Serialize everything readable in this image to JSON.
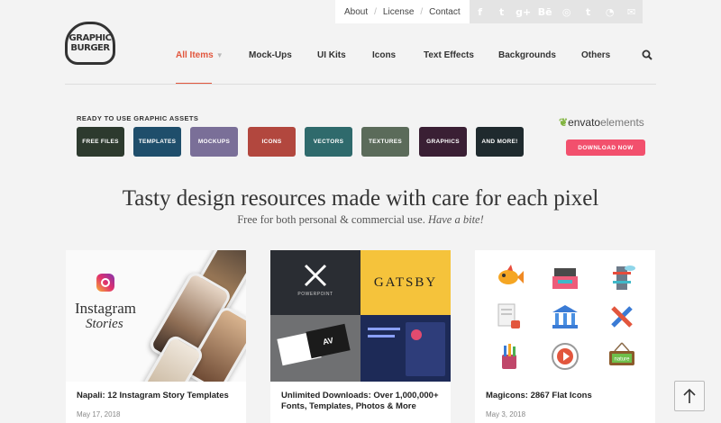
{
  "utility_links": [
    "About",
    "License",
    "Contact"
  ],
  "social_icons": [
    "facebook-icon",
    "twitter-icon",
    "google-plus-icon",
    "behance-icon",
    "dribbble-icon",
    "tumblr-icon",
    "rss-icon",
    "mail-icon"
  ],
  "social_glyphs": [
    "f",
    "t",
    "g+",
    "Bē",
    "◎",
    "t",
    "◔",
    "✉"
  ],
  "logo": {
    "line1": "GRAPHIC",
    "line2": "BURGER"
  },
  "nav": {
    "items": [
      "All Items",
      "Mock-Ups",
      "UI Kits",
      "Icons",
      "Text Effects",
      "Backgrounds",
      "Others"
    ],
    "active": "All Items",
    "accent": "#e2563d"
  },
  "assets": {
    "title": "READY TO USE GRAPHIC ASSETS",
    "tiles": [
      {
        "label": "FREE FILES",
        "color": "#2d3a2e"
      },
      {
        "label": "TEMPLATES",
        "color": "#1f4e6b"
      },
      {
        "label": "MOCKUPS",
        "color": "#7a6f98"
      },
      {
        "label": "ICONS",
        "color": "#b2473e"
      },
      {
        "label": "VECTORS",
        "color": "#2f6a6c"
      },
      {
        "label": "TEXTURES",
        "color": "#5b6b5a"
      },
      {
        "label": "GRAPHICS",
        "color": "#3a1f34"
      },
      {
        "label": "AND MORE!",
        "color": "#1f2a2e"
      }
    ],
    "envato_brand": "envato",
    "envato_suffix": "elements",
    "download_label": "DOWNLOAD NOW",
    "download_color": "#f2506d"
  },
  "headline": "Tasty design resources made with care for each pixel",
  "subline_plain": "Free for both personal & commercial use.",
  "subline_emph": "Have a bite!",
  "cards": [
    {
      "title": "Napali: 12 Instagram Story Templates",
      "date": "May 17, 2018",
      "art_line1": "Instagram",
      "art_line2": "Stories"
    },
    {
      "title": "Unlimited Downloads: Over 1,000,000+ Fonts, Templates, Photos & More",
      "date": "",
      "art_brand": "GATSBY",
      "art_powerpoint": "POWERPOINT",
      "art_av": "AV"
    },
    {
      "title": "Magicons: 2867 Flat Icons",
      "date": "May 3, 2018",
      "art_sign": "nature"
    }
  ]
}
